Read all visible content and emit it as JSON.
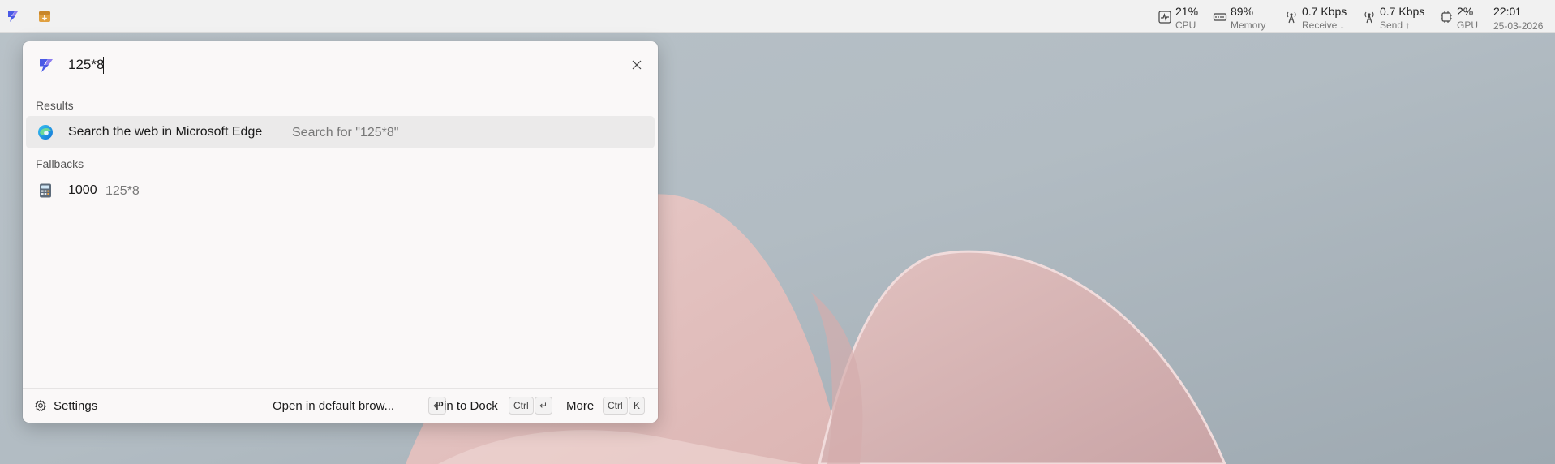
{
  "topbar": {
    "apps": [
      {
        "icon": "command-palette-icon",
        "color": "#4a5ae6"
      },
      {
        "icon": "archive-download-icon",
        "color": "#e0a040"
      }
    ],
    "stats": {
      "cpu": {
        "value": "21%",
        "label": "CPU"
      },
      "memory": {
        "value": "89%",
        "label": "Memory"
      },
      "receive": {
        "value": "0.7 Kbps",
        "label": "Receive ↓"
      },
      "send": {
        "value": "0.7 Kbps",
        "label": "Send ↑"
      },
      "gpu": {
        "value": "2%",
        "label": "GPU"
      }
    },
    "clock": {
      "time": "22:01",
      "date": "25-03-2026"
    }
  },
  "palette": {
    "query": "125*8",
    "sections": {
      "results": "Results",
      "fallbacks": "Fallbacks"
    },
    "results": [
      {
        "title": "Search the web in Microsoft Edge",
        "subtitle": "Search for \"125*8\"",
        "icon": "edge-browser-icon",
        "selected": true
      }
    ],
    "fallbacks": [
      {
        "title": "1000",
        "subtitle": "125*8",
        "icon": "calculator-icon"
      }
    ],
    "footer": {
      "settings": "Settings",
      "primary_action": {
        "label": "Open in default brow...",
        "keys": [
          "↵"
        ]
      },
      "pin_action": {
        "label": "Pin to Dock",
        "keys": [
          "Ctrl",
          "↵"
        ]
      },
      "more_action": {
        "label": "More",
        "keys": [
          "Ctrl",
          "K"
        ]
      }
    }
  },
  "colors": {
    "accent": "#4a5ae6",
    "wallpaper_base": "#a9b3bb",
    "wallpaper_petal": "#e3c3c1"
  }
}
